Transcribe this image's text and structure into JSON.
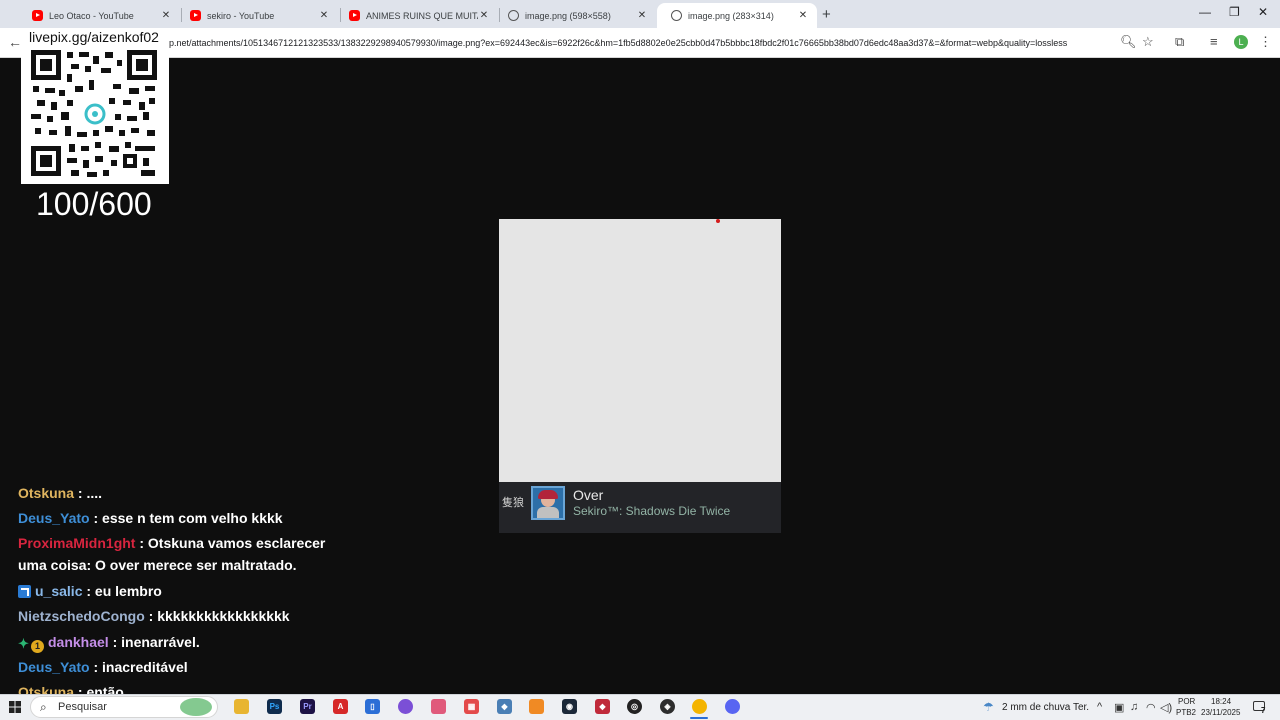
{
  "browser": {
    "tabs": [
      {
        "title": "Leo Otaco - YouTube",
        "icon": "youtube-icon"
      },
      {
        "title": "sekiro - YouTube",
        "icon": "youtube-icon"
      },
      {
        "title": "ANIMES RUINS QUE MUITA GENTE",
        "icon": "youtube-icon"
      },
      {
        "title": "image.png (598×558)",
        "icon": "globe-icon"
      },
      {
        "title": "image.png (283×314)",
        "icon": "globe-icon"
      }
    ],
    "url": "p.net/attachments/1051346712121323533/1383229298940579930/image.png?ex=692443ec&is=6922f26c&hm=1fb5d8802e0e25cbb0d47b5bbbc18fbdc2f01c76665bb38bd07d6edc48aa3d37&=&format=webp&quality=lossless",
    "profile_initial": "L"
  },
  "overlay": {
    "qr_label": "livepix.gg/aizenkof02",
    "goal": "100/600"
  },
  "achievement": {
    "title": "Over",
    "game": "Sekiro™: Shadows Die Twice",
    "logo": "隻狼"
  },
  "chat": [
    {
      "user": "Otskuna",
      "text": " : ...."
    },
    {
      "user": "Deus_Yato",
      "text": " : esse n tem com velho kkkk"
    },
    {
      "user": "ProximaMidn1ght",
      "text": " : Otskuna vamos esclarecer",
      "cont": "uma coisa: O over merece ser maltratado."
    },
    {
      "user": "u_salic",
      "text": " : eu lembro"
    },
    {
      "user": "NietzschedoCongo",
      "text": " : kkkkkkkkkkkkkkkkk"
    },
    {
      "user": "dankhael",
      "text": " : inenarrável."
    },
    {
      "user": "Deus_Yato",
      "text": " : inacreditável"
    },
    {
      "user": "Otskuna",
      "text": " : então"
    }
  ],
  "taskbar": {
    "search_placeholder": "Pesquisar",
    "weather": "2 mm de chuva Ter.",
    "lang1": "POR",
    "lang2": "PTB2",
    "time": "18:24",
    "date": "23/11/2025",
    "notification_count": "7"
  }
}
